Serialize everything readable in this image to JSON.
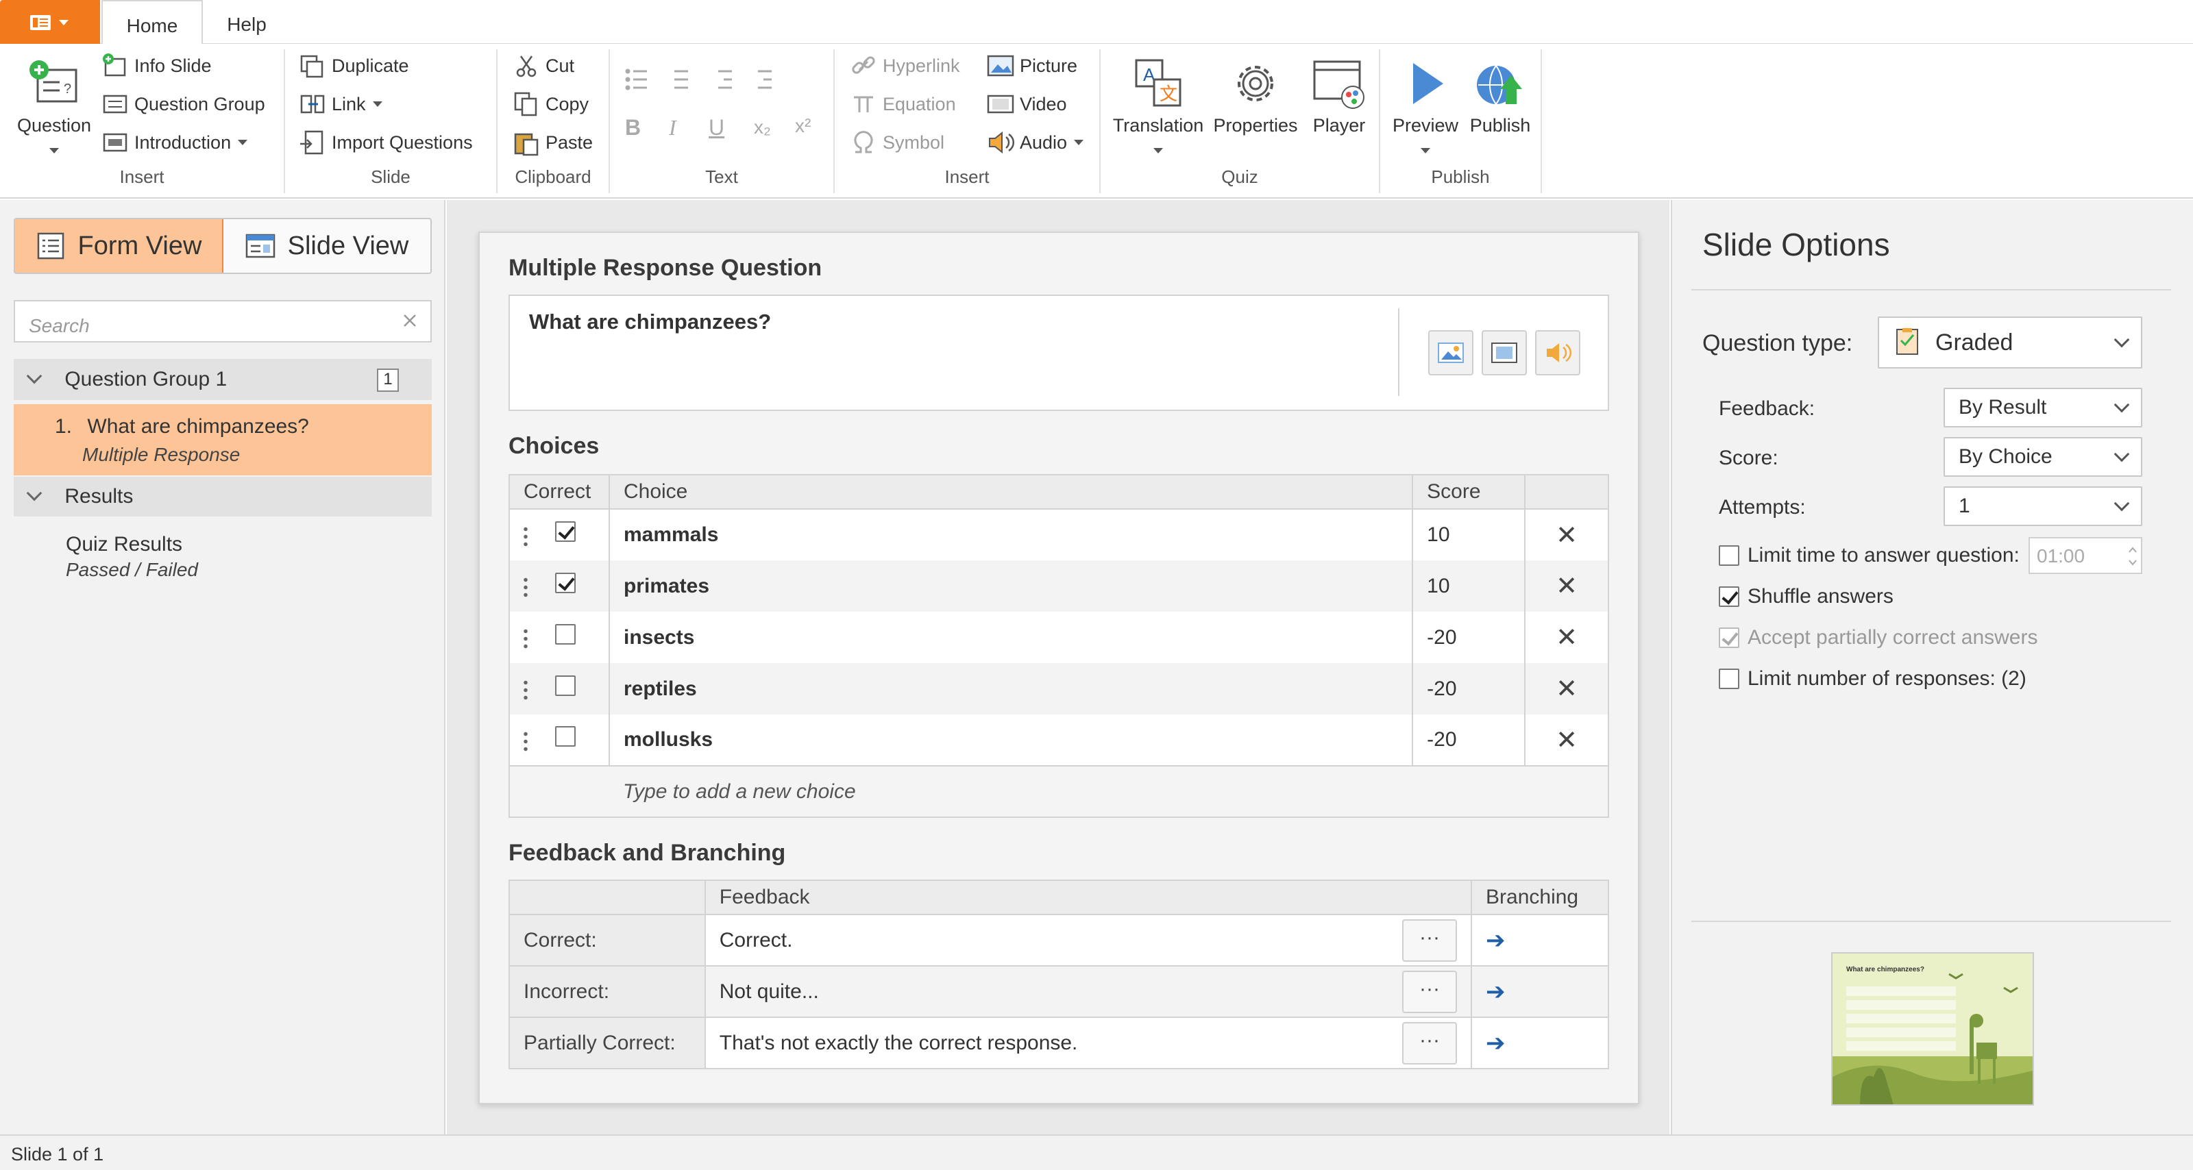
{
  "tabs": {
    "home": "Home",
    "help": "Help"
  },
  "ribbon": {
    "insert": {
      "question": "Question",
      "info_slide": "Info Slide",
      "question_group": "Question Group",
      "introduction": "Introduction",
      "label": "Insert"
    },
    "slide": {
      "duplicate": "Duplicate",
      "link": "Link",
      "import_questions": "Import Questions",
      "label": "Slide"
    },
    "clipboard": {
      "cut": "Cut",
      "copy": "Copy",
      "paste": "Paste",
      "label": "Clipboard"
    },
    "text": {
      "bold": "B",
      "italic": "I",
      "underline": "U",
      "subscript": "x₂",
      "superscript": "x²",
      "label": "Text"
    },
    "insert2": {
      "hyperlink": "Hyperlink",
      "equation": "Equation",
      "symbol": "Symbol",
      "picture": "Picture",
      "video": "Video",
      "audio": "Audio",
      "label": "Insert"
    },
    "quiz": {
      "translation": "Translation",
      "properties": "Properties",
      "player": "Player",
      "label": "Quiz"
    },
    "publish": {
      "preview": "Preview",
      "publish": "Publish",
      "label": "Publish"
    }
  },
  "left": {
    "form_view": "Form View",
    "slide_view": "Slide View",
    "search_placeholder": "Search",
    "group_title": "Question Group 1",
    "group_count": "1",
    "question_index": "1.",
    "question_title": "What are chimpanzees?",
    "question_type": "Multiple Response",
    "results_title": "Results",
    "quiz_results": "Quiz Results",
    "quiz_results_sub": "Passed / Failed"
  },
  "center": {
    "section_title": "Multiple Response Question",
    "question_text": "What are chimpanzees?",
    "choices_title": "Choices",
    "col_correct": "Correct",
    "col_choice": "Choice",
    "col_score": "Score",
    "choices": [
      {
        "correct": true,
        "text": "mammals",
        "score": "10"
      },
      {
        "correct": true,
        "text": "primates",
        "score": "10"
      },
      {
        "correct": false,
        "text": "insects",
        "score": "-20"
      },
      {
        "correct": false,
        "text": "reptiles",
        "score": "-20"
      },
      {
        "correct": false,
        "text": "mollusks",
        "score": "-20"
      }
    ],
    "add_choice": "Type to add a new choice",
    "feedback_title": "Feedback and Branching",
    "col_feedback": "Feedback",
    "col_branching": "Branching",
    "feedback": [
      {
        "label": "Correct:",
        "text": "Correct."
      },
      {
        "label": "Incorrect:",
        "text": "Not quite..."
      },
      {
        "label": "Partially Correct:",
        "text": "That's not exactly the correct response."
      }
    ],
    "more": "···",
    "branch_arrow": "➔",
    "remove": "✕"
  },
  "right": {
    "title": "Slide Options",
    "question_type_label": "Question type:",
    "question_type_value": "Graded",
    "feedback_label": "Feedback:",
    "feedback_value": "By Result",
    "score_label": "Score:",
    "score_value": "By Choice",
    "attempts_label": "Attempts:",
    "attempts_value": "1",
    "limit_time_label": "Limit time to answer question:",
    "limit_time_value": "01:00",
    "shuffle_label": "Shuffle answers",
    "accept_partial_label": "Accept partially correct answers",
    "limit_responses_label": "Limit number of responses: (2)",
    "limit_time_checked": false,
    "shuffle_checked": true,
    "accept_partial_checked": true,
    "limit_responses_checked": false
  },
  "thumbnail": {
    "title": "What are chimpanzees?"
  },
  "status": {
    "text": "Slide 1 of 1"
  },
  "colors": {
    "accent": "#f27a1a",
    "selected": "#fdc597",
    "link_blue": "#1f5fa8"
  }
}
